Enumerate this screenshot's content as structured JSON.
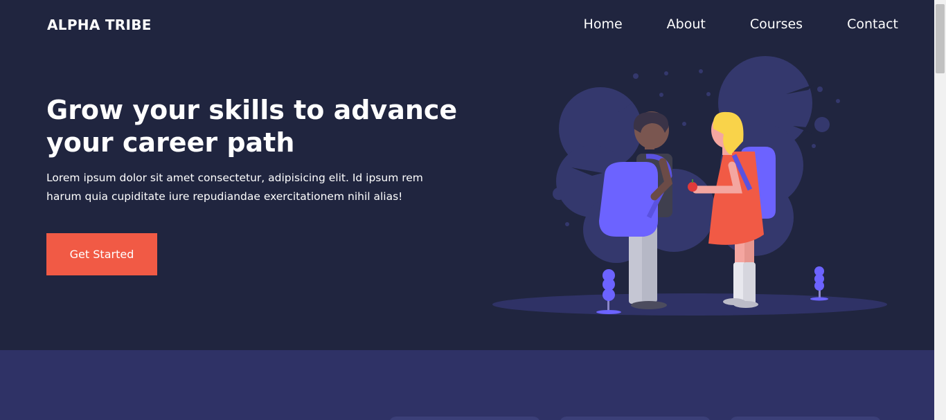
{
  "brand": {
    "logo": "ALPHA TRIBE"
  },
  "nav": {
    "items": [
      {
        "label": "Home"
      },
      {
        "label": "About"
      },
      {
        "label": "Courses"
      },
      {
        "label": "Contact"
      }
    ]
  },
  "hero": {
    "title": "Grow your skills to advance your career path",
    "text": "Lorem ipsum dolor sit amet consectetur, adipisicing elit. Id ipsum rem harum quia cupiditate iure repudiandae exercitationem nihil alias!",
    "cta_label": "Get Started"
  },
  "colors": {
    "background": "#20253f",
    "accent": "#f15a45",
    "section2": "#2f3266",
    "illustration_purple": "#6c63ff"
  }
}
